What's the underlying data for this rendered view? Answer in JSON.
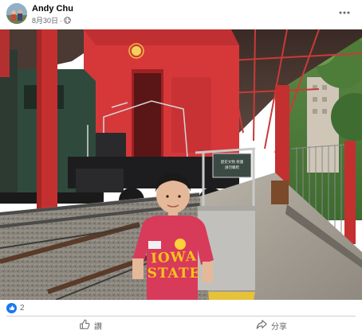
{
  "post": {
    "author": "Andy Chu",
    "date": "8月30日",
    "separator": "·",
    "reaction_count": "2",
    "actions": {
      "like_label": "讚",
      "share_label": "分享"
    }
  },
  "photo_text": {
    "plaque_line1": "歷史文物 保護",
    "plaque_line2": "請勿攀爬",
    "shirt_line1": "IOWA",
    "shirt_line2": "STATE"
  },
  "icons": {
    "privacy": "globe-icon",
    "more": "more-options-icon",
    "reaction": "thumbs-up-icon",
    "like": "thumbs-up-outline-icon",
    "share": "share-arrow-icon"
  },
  "colors": {
    "accent": "#1877f2",
    "muted_text": "#65676b",
    "divider": "#ced0d4",
    "station_red": "#d6383a"
  }
}
